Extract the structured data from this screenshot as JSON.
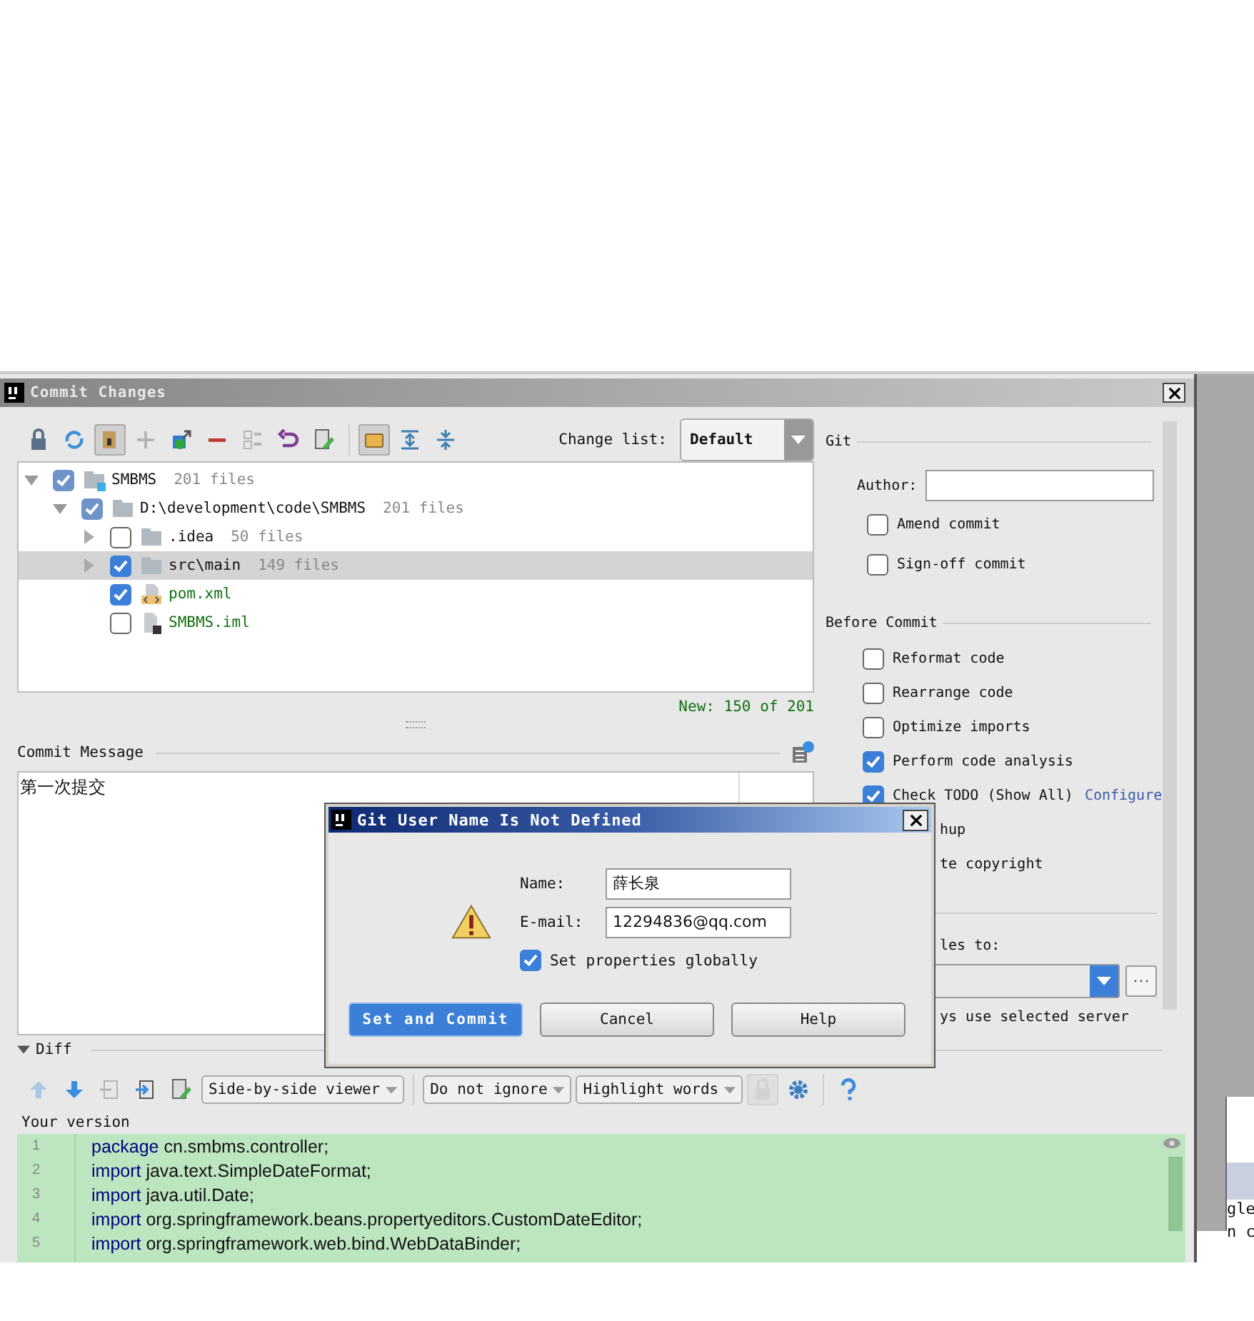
{
  "window": {
    "title": "Commit Changes"
  },
  "toolbar": [
    {
      "kind": "lock",
      "pressed": false,
      "disabled": false
    },
    {
      "kind": "refresh",
      "pressed": false,
      "disabled": false
    },
    {
      "kind": "unversioned",
      "pressed": true,
      "disabled": false
    },
    {
      "kind": "add",
      "pressed": false,
      "disabled": true
    },
    {
      "kind": "jump",
      "pressed": false,
      "disabled": false
    },
    {
      "kind": "remove",
      "pressed": false,
      "disabled": false
    },
    {
      "kind": "group",
      "pressed": false,
      "disabled": true
    },
    {
      "kind": "revert",
      "pressed": false,
      "disabled": false
    },
    {
      "kind": "edit",
      "pressed": false,
      "disabled": false
    },
    {
      "kind": "separator"
    },
    {
      "kind": "directory",
      "pressed": true,
      "disabled": false
    },
    {
      "kind": "expand",
      "pressed": false,
      "disabled": false
    },
    {
      "kind": "collapse",
      "pressed": false,
      "disabled": false
    }
  ],
  "change_list": {
    "label": "Change list:",
    "value": "Default"
  },
  "tree": [
    {
      "kind": "module",
      "label": "SMBMS",
      "count": "201 files",
      "checked": true,
      "partial": true,
      "expanded": true,
      "selected": false,
      "new": false,
      "children": [
        {
          "kind": "folder",
          "label": "D:\\development\\code\\SMBMS",
          "count": "201 files",
          "checked": true,
          "partial": true,
          "expanded": true,
          "selected": false,
          "new": false,
          "children": [
            {
              "kind": "folder",
              "label": ".idea",
              "count": "50 files",
              "checked": false,
              "expanded": false,
              "selected": false,
              "new": false
            },
            {
              "kind": "folder",
              "label": "src\\main",
              "count": "149 files",
              "checked": true,
              "expanded": false,
              "selected": true,
              "new": false
            },
            {
              "kind": "xml",
              "label": "pom.xml",
              "checked": true,
              "selected": false,
              "new": true
            },
            {
              "kind": "iml",
              "label": "SMBMS.iml",
              "checked": false,
              "selected": false,
              "new": true
            }
          ]
        }
      ]
    }
  ],
  "tree_summary": "New: 150 of 201",
  "commit_message": {
    "label": "Commit Message",
    "value": "第一次提交"
  },
  "git": {
    "title": "Git",
    "author_label": "Author:",
    "options": [
      {
        "label": "Amend commit",
        "checked": false
      },
      {
        "label": "Sign-off commit",
        "checked": false
      }
    ]
  },
  "before_commit": {
    "title": "Before Commit",
    "options": [
      {
        "kind": "checkbox",
        "label": "Reformat code",
        "checked": false
      },
      {
        "kind": "checkbox",
        "label": "Rearrange code",
        "checked": false
      },
      {
        "kind": "checkbox",
        "label": "Optimize imports",
        "checked": false
      },
      {
        "kind": "checkbox",
        "label": "Perform code analysis",
        "checked": true
      },
      {
        "kind": "checkbox",
        "label": "Check TODO (Show All)",
        "link": "Configure",
        "checked": true
      },
      {
        "kind": "covered",
        "label": "hup"
      },
      {
        "kind": "covered",
        "label": "te copyright"
      }
    ]
  },
  "upload": {
    "label": "les to:",
    "note": "ys use selected server"
  },
  "diff": {
    "title": "Diff",
    "expanded": true,
    "toolbar": [
      {
        "kind": "up",
        "disabled": true
      },
      {
        "kind": "down",
        "disabled": false
      },
      {
        "kind": "file",
        "disabled": true
      },
      {
        "kind": "import",
        "disabled": false
      },
      {
        "kind": "edit",
        "disabled": false
      }
    ],
    "viewer": "Side-by-side viewer",
    "ignore": "Do not ignore",
    "highlight": "Highlight words",
    "version_label": "Your version",
    "lines": [
      {
        "number": "1",
        "keyword": "package",
        "code": "cn.smbms.controller;"
      },
      {
        "number": "2",
        "keyword": "import",
        "code": "java.text.SimpleDateFormat;"
      },
      {
        "number": "3",
        "keyword": "import",
        "code": "java.util.Date;"
      },
      {
        "number": "4",
        "keyword": "import",
        "code": "org.springframework.beans.propertyeditors.CustomDateEditor;"
      },
      {
        "number": "5",
        "keyword": "import",
        "code": "org.springframework.web.bind.WebDataBinder;"
      }
    ]
  },
  "modal": {
    "title": "Git User Name Is Not Defined",
    "name_label": "Name:",
    "name_value": "薛长泉",
    "email_label": "E-mail:",
    "email_value": "12294836@qq.com",
    "global": {
      "label": "Set properties globally",
      "checked": true
    },
    "buttons": [
      {
        "label": "Set and Commit",
        "default": true
      },
      {
        "label": "Cancel",
        "default": false
      },
      {
        "label": "Help",
        "default": false
      }
    ]
  },
  "background_window": {
    "lines": [
      "gle",
      "n c"
    ]
  }
}
